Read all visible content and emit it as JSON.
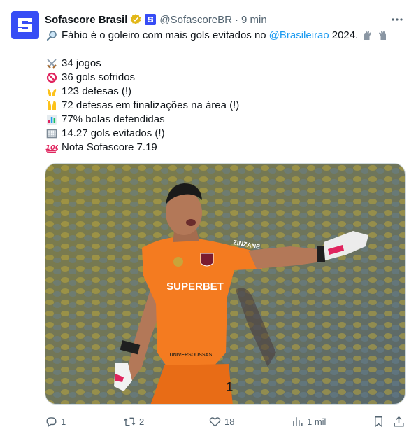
{
  "author": {
    "name": "Sofascore Brasil",
    "handle": "@SofascoreBR",
    "time": "9 min"
  },
  "tweet": {
    "line1_pre": "Fábio é o goleiro com mais gols evitados no",
    "line1_mention": "@Brasileirao",
    "line1_post": "2024.",
    "stats": [
      {
        "icon": "crossed-swords-icon",
        "text": "34 jogos"
      },
      {
        "icon": "prohibited-icon",
        "text": "36 gols sofridos"
      },
      {
        "icon": "open-hands-icon",
        "text": "123 defesas (!)"
      },
      {
        "icon": "raised-hands-icon",
        "text": "72 defesas em finalizações na área (!)"
      },
      {
        "icon": "bar-chart-icon",
        "text": "77% bolas defendidas"
      },
      {
        "icon": "goal-net-icon",
        "text": "14.27 gols evitados (!)"
      },
      {
        "icon": "hundred-points-icon",
        "text": "Nota Sofascore 7.19"
      }
    ]
  },
  "media": {
    "shirt_sponsor": "SUPERBET",
    "shirt_text_top": "ZINZANE",
    "shirt_text_bottom": "UNIVERSOUSSAS",
    "shirt_number": "1"
  },
  "actions": {
    "replies": "1",
    "reposts": "2",
    "likes": "18",
    "views": "1 mil"
  },
  "colors": {
    "brand": "#374df5",
    "link": "#1d9bf0",
    "muted": "#536471",
    "verified": "#e2b719",
    "jersey": "#f47b20"
  }
}
